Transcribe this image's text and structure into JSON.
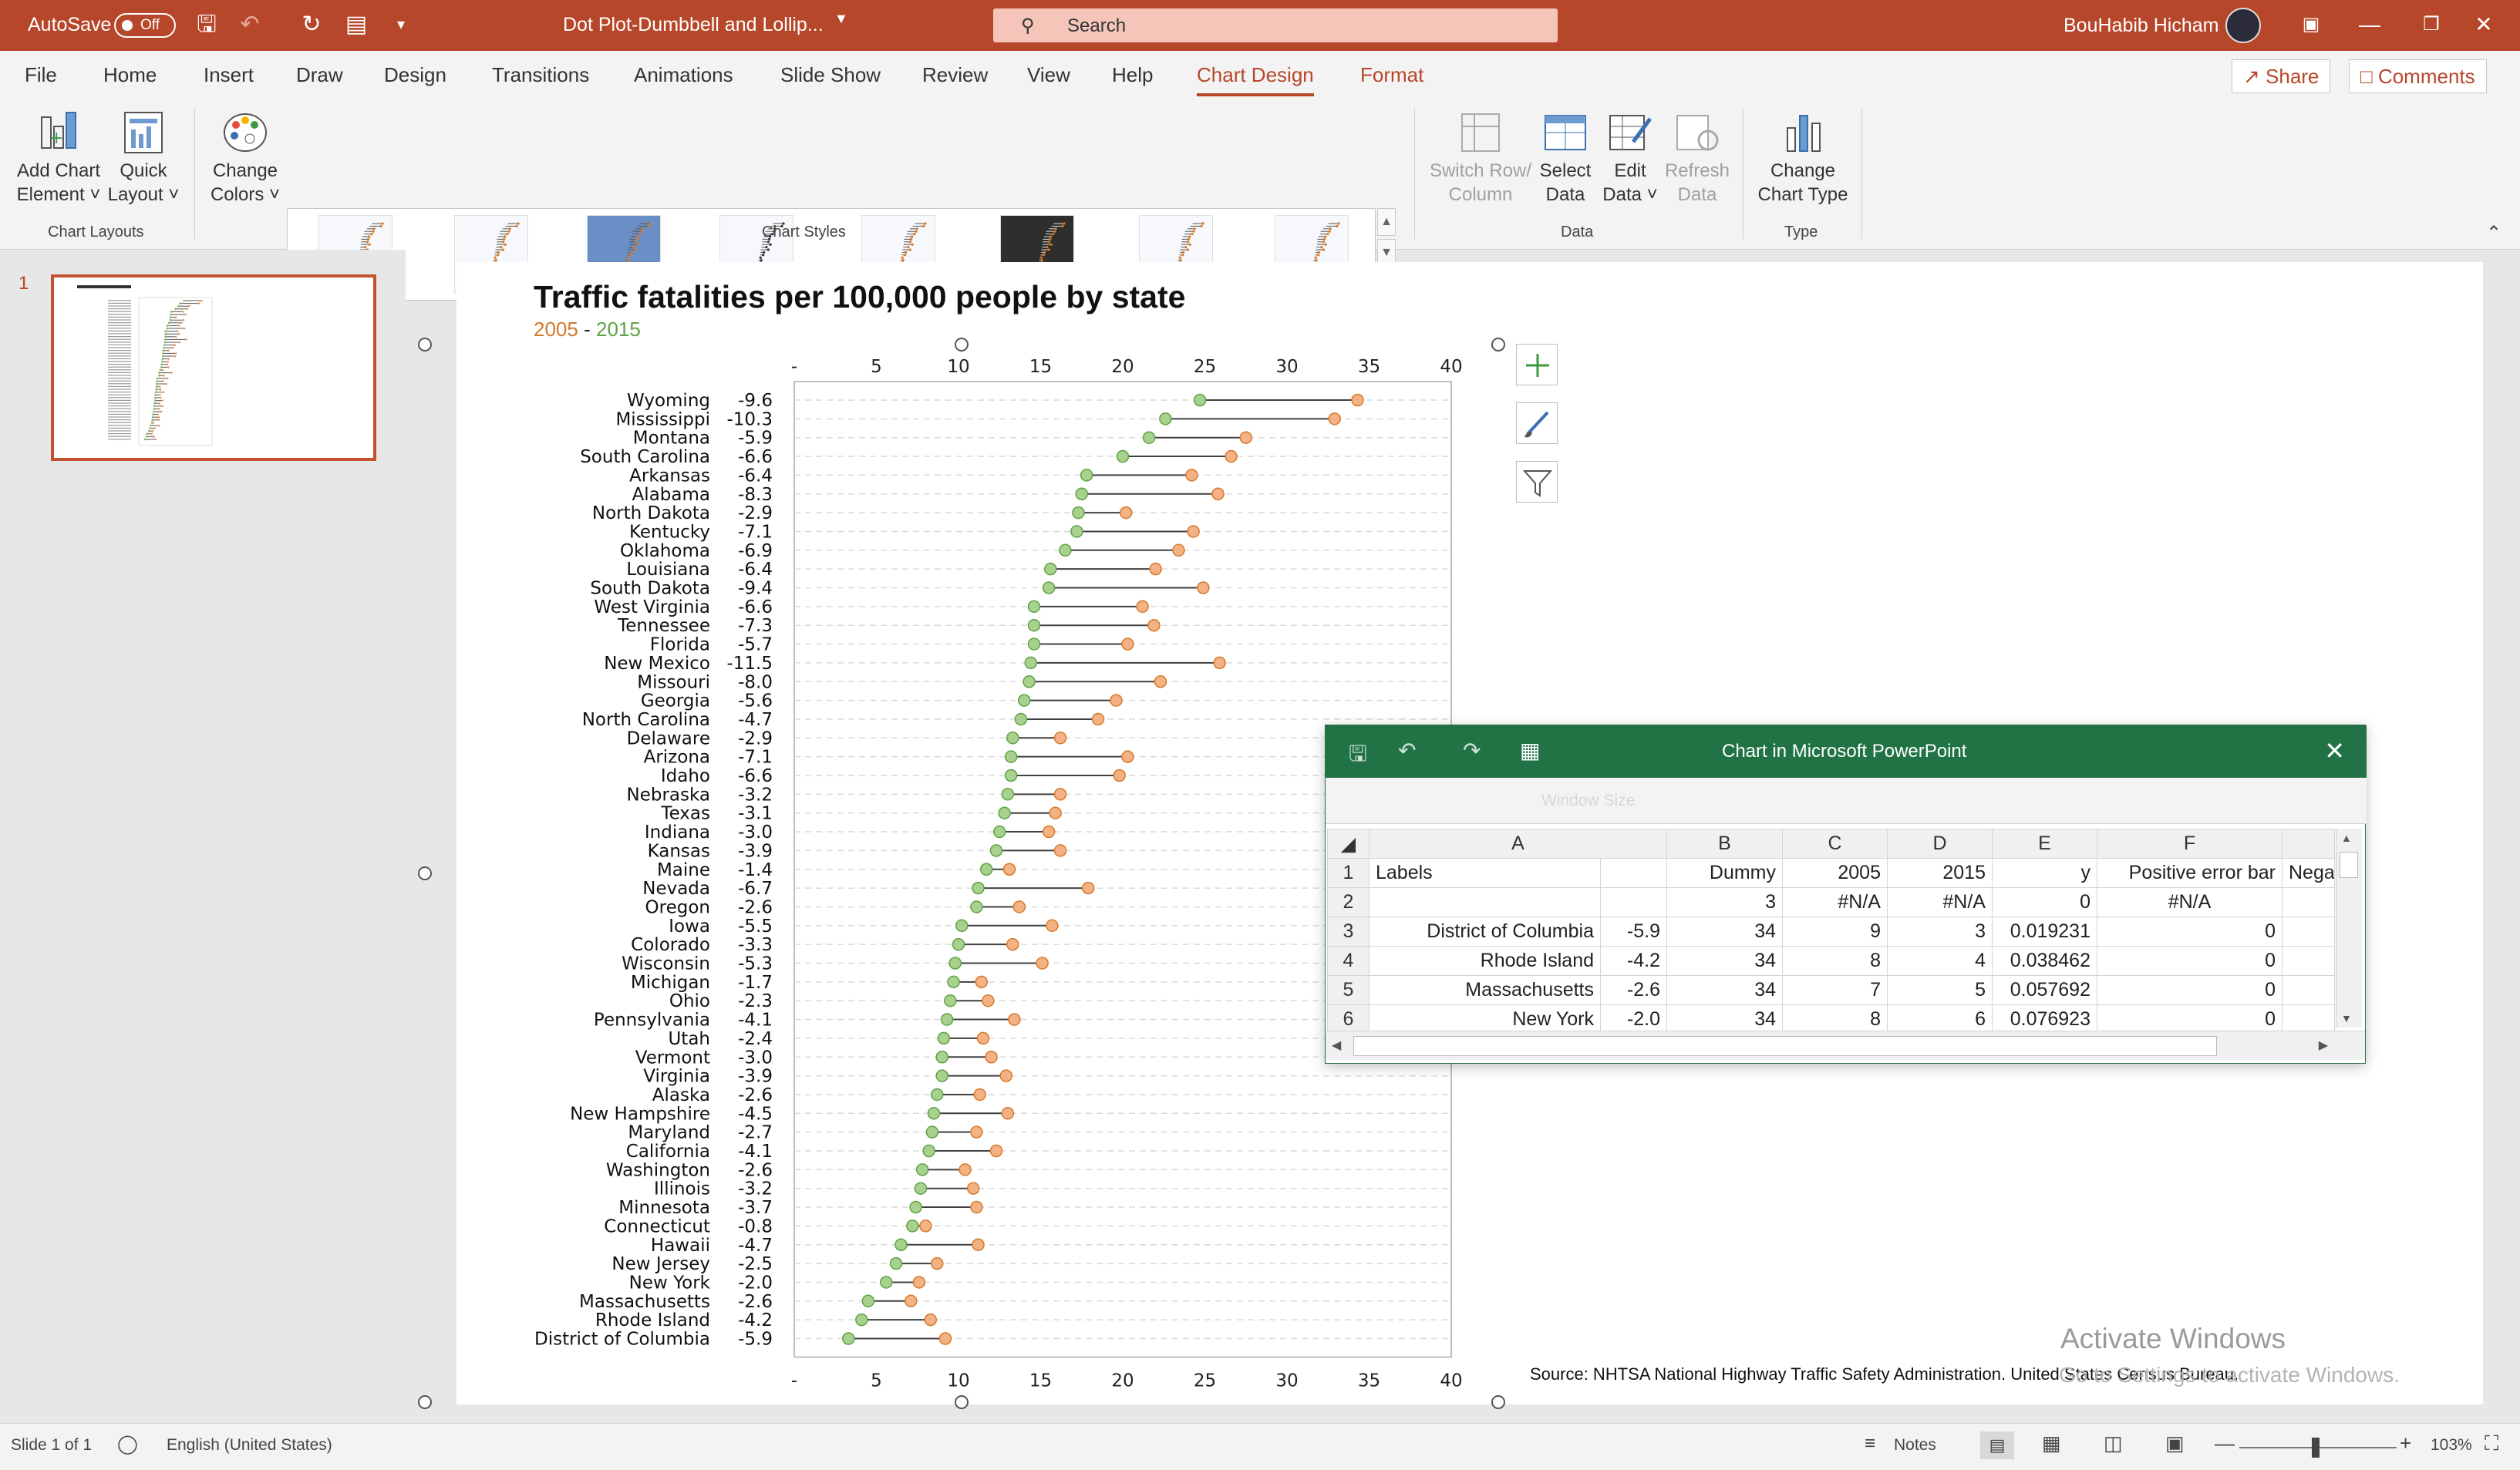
{
  "titlebar": {
    "autosave": "AutoSave",
    "autosave_state": "Off",
    "doc_title": "Dot Plot-Dumbbell and Lollip...",
    "search_placeholder": "Search",
    "user_name": "BouHabib Hicham"
  },
  "tabs": [
    "File",
    "Home",
    "Insert",
    "Draw",
    "Design",
    "Transitions",
    "Animations",
    "Slide Show",
    "Review",
    "View",
    "Help",
    "Chart Design",
    "Format"
  ],
  "active_tab": "Chart Design",
  "share": "Share",
  "comments": "Comments",
  "ribbon": {
    "add_chart_element": [
      "Add Chart",
      "Element"
    ],
    "quick_layout": [
      "Quick",
      "Layout"
    ],
    "change_colors": [
      "Change",
      "Colors"
    ],
    "chart_layouts": "Chart Layouts",
    "chart_styles": "Chart Styles",
    "switch_row_column": [
      "Switch Row/",
      "Column"
    ],
    "select_data": [
      "Select",
      "Data"
    ],
    "edit_data": [
      "Edit",
      "Data"
    ],
    "refresh_data": [
      "Refresh",
      "Data"
    ],
    "data_group": "Data",
    "change_chart_type": [
      "Change",
      "Chart Type"
    ],
    "type_group": "Type"
  },
  "slide_number": "1",
  "chart_data": {
    "type": "scatter",
    "title": "Traffic fatalities per 100,000 people by state",
    "legend": {
      "y2005": "2005",
      "sep": "-",
      "y2015": "2015"
    },
    "series": [
      {
        "name": "2005",
        "color": "#f4b183"
      },
      {
        "name": "2015",
        "color": "#a9d18e"
      }
    ],
    "xlim": [
      0,
      40
    ],
    "xticks": [
      "-",
      "5",
      "10",
      "15",
      "20",
      "25",
      "30",
      "35",
      "40"
    ],
    "grid": "horizontal dashed",
    "rows": [
      {
        "state": "Wyoming",
        "change": "-9.6",
        "y2005": 34.3,
        "y2015": 24.7
      },
      {
        "state": "Mississippi",
        "change": "-10.3",
        "y2005": 32.9,
        "y2015": 22.6
      },
      {
        "state": "Montana",
        "change": "-5.9",
        "y2005": 27.5,
        "y2015": 21.6
      },
      {
        "state": "South Carolina",
        "change": "-6.6",
        "y2005": 26.6,
        "y2015": 20.0
      },
      {
        "state": "Arkansas",
        "change": "-6.4",
        "y2005": 24.2,
        "y2015": 17.8
      },
      {
        "state": "Alabama",
        "change": "-8.3",
        "y2005": 25.8,
        "y2015": 17.5
      },
      {
        "state": "North Dakota",
        "change": "-2.9",
        "y2005": 20.2,
        "y2015": 17.3
      },
      {
        "state": "Kentucky",
        "change": "-7.1",
        "y2005": 24.3,
        "y2015": 17.2
      },
      {
        "state": "Oklahoma",
        "change": "-6.9",
        "y2005": 23.4,
        "y2015": 16.5
      },
      {
        "state": "Louisiana",
        "change": "-6.4",
        "y2005": 22.0,
        "y2015": 15.6
      },
      {
        "state": "South Dakota",
        "change": "-9.4",
        "y2005": 24.9,
        "y2015": 15.5
      },
      {
        "state": "West Virginia",
        "change": "-6.6",
        "y2005": 21.2,
        "y2015": 14.6
      },
      {
        "state": "Tennessee",
        "change": "-7.3",
        "y2005": 21.9,
        "y2015": 14.6
      },
      {
        "state": "Florida",
        "change": "-5.7",
        "y2005": 20.3,
        "y2015": 14.6
      },
      {
        "state": "New Mexico",
        "change": "-11.5",
        "y2005": 25.9,
        "y2015": 14.4
      },
      {
        "state": "Missouri",
        "change": "-8.0",
        "y2005": 22.3,
        "y2015": 14.3
      },
      {
        "state": "Georgia",
        "change": "-5.6",
        "y2005": 19.6,
        "y2015": 14.0
      },
      {
        "state": "North Carolina",
        "change": "-4.7",
        "y2005": 18.5,
        "y2015": 13.8
      },
      {
        "state": "Delaware",
        "change": "-2.9",
        "y2005": 16.2,
        "y2015": 13.3
      },
      {
        "state": "Arizona",
        "change": "-7.1",
        "y2005": 20.3,
        "y2015": 13.2
      },
      {
        "state": "Idaho",
        "change": "-6.6",
        "y2005": 19.8,
        "y2015": 13.2
      },
      {
        "state": "Nebraska",
        "change": "-3.2",
        "y2005": 16.2,
        "y2015": 13.0
      },
      {
        "state": "Texas",
        "change": "-3.1",
        "y2005": 15.9,
        "y2015": 12.8
      },
      {
        "state": "Indiana",
        "change": "-3.0",
        "y2005": 15.5,
        "y2015": 12.5
      },
      {
        "state": "Kansas",
        "change": "-3.9",
        "y2005": 16.2,
        "y2015": 12.3
      },
      {
        "state": "Maine",
        "change": "-1.4",
        "y2005": 13.1,
        "y2015": 11.7
      },
      {
        "state": "Nevada",
        "change": "-6.7",
        "y2005": 17.9,
        "y2015": 11.2
      },
      {
        "state": "Oregon",
        "change": "-2.6",
        "y2005": 13.7,
        "y2015": 11.1
      },
      {
        "state": "Iowa",
        "change": "-5.5",
        "y2005": 15.7,
        "y2015": 10.2
      },
      {
        "state": "Colorado",
        "change": "-3.3",
        "y2005": 13.3,
        "y2015": 10.0
      },
      {
        "state": "Wisconsin",
        "change": "-5.3",
        "y2005": 15.1,
        "y2015": 9.8
      },
      {
        "state": "Michigan",
        "change": "-1.7",
        "y2005": 11.4,
        "y2015": 9.7
      },
      {
        "state": "Ohio",
        "change": "-2.3",
        "y2005": 11.8,
        "y2015": 9.5
      },
      {
        "state": "Pennsylvania",
        "change": "-4.1",
        "y2005": 13.4,
        "y2015": 9.3
      },
      {
        "state": "Utah",
        "change": "-2.4",
        "y2005": 11.5,
        "y2015": 9.1
      },
      {
        "state": "Vermont",
        "change": "-3.0",
        "y2005": 12.0,
        "y2015": 9.0
      },
      {
        "state": "Virginia",
        "change": "-3.9",
        "y2005": 12.9,
        "y2015": 9.0
      },
      {
        "state": "Alaska",
        "change": "-2.6",
        "y2005": 11.3,
        "y2015": 8.7
      },
      {
        "state": "New Hampshire",
        "change": "-4.5",
        "y2005": 13.0,
        "y2015": 8.5
      },
      {
        "state": "Maryland",
        "change": "-2.7",
        "y2005": 11.1,
        "y2015": 8.4
      },
      {
        "state": "California",
        "change": "-4.1",
        "y2005": 12.3,
        "y2015": 8.2
      },
      {
        "state": "Washington",
        "change": "-2.6",
        "y2005": 10.4,
        "y2015": 7.8
      },
      {
        "state": "Illinois",
        "change": "-3.2",
        "y2005": 10.9,
        "y2015": 7.7
      },
      {
        "state": "Minnesota",
        "change": "-3.7",
        "y2005": 11.1,
        "y2015": 7.4
      },
      {
        "state": "Connecticut",
        "change": "-0.8",
        "y2005": 8.0,
        "y2015": 7.2
      },
      {
        "state": "Hawaii",
        "change": "-4.7",
        "y2005": 11.2,
        "y2015": 6.5
      },
      {
        "state": "New Jersey",
        "change": "-2.5",
        "y2005": 8.7,
        "y2015": 6.2
      },
      {
        "state": "New York",
        "change": "-2.0",
        "y2005": 7.6,
        "y2015": 5.6
      },
      {
        "state": "Massachusetts",
        "change": "-2.6",
        "y2005": 7.1,
        "y2015": 4.5
      },
      {
        "state": "Rhode Island",
        "change": "-4.2",
        "y2005": 8.3,
        "y2015": 4.1
      },
      {
        "state": "District of Columbia",
        "change": "-5.9",
        "y2005": 9.2,
        "y2015": 3.3
      }
    ],
    "source": "Source: NHTSA National Highway Traffic Safety Administration. United States Census Bureau."
  },
  "excel": {
    "title": "Chart in Microsoft PowerPoint",
    "toolbar_hint": "Window Size",
    "columns": [
      "A",
      "B",
      "C",
      "D",
      "E",
      "F"
    ],
    "headers": [
      "Labels",
      "",
      "Dummy",
      "2005",
      "2015",
      "y",
      "Positive error bar",
      "Negat"
    ],
    "rows": [
      {
        "n": "2",
        "cells": [
          "",
          "",
          "3",
          "#N/A",
          "#N/A",
          "0",
          "#N/A",
          ""
        ]
      },
      {
        "n": "3",
        "cells": [
          "District of Columbia",
          "-5.9",
          "34",
          "9",
          "3",
          "0.019231",
          "0",
          ""
        ]
      },
      {
        "n": "4",
        "cells": [
          "Rhode Island",
          "-4.2",
          "34",
          "8",
          "4",
          "0.038462",
          "0",
          ""
        ]
      },
      {
        "n": "5",
        "cells": [
          "Massachusetts",
          "-2.6",
          "34",
          "7",
          "5",
          "0.057692",
          "0",
          ""
        ]
      },
      {
        "n": "6",
        "cells": [
          "New York",
          "-2.0",
          "34",
          "8",
          "6",
          "0.076923",
          "0",
          ""
        ]
      }
    ]
  },
  "watermark": {
    "line1": "Activate Windows",
    "line2": "Go to Settings to activate Windows."
  },
  "status": {
    "slide": "Slide 1 of 1",
    "language": "English (United States)",
    "notes": "Notes",
    "zoom": "103%"
  },
  "colors": {
    "accent": "#b7472a",
    "excel_green": "#217346",
    "dot_2005": "#f4b183",
    "dot_2015": "#a9d18e"
  }
}
